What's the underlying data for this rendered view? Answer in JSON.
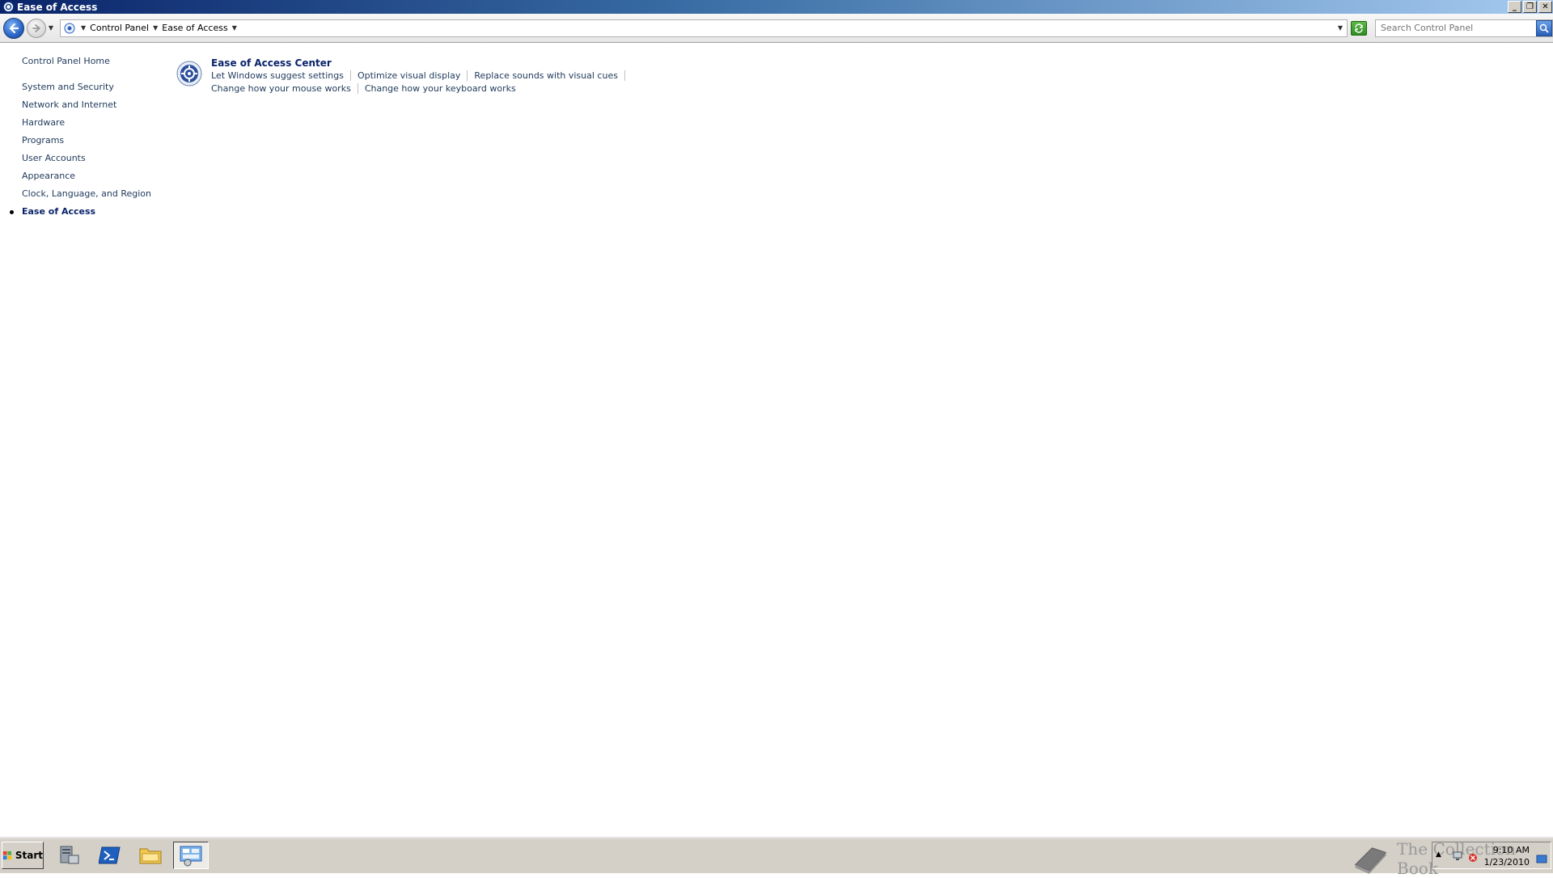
{
  "window": {
    "title": "Ease of Access"
  },
  "navbar": {
    "breadcrumbs": [
      "Control Panel",
      "Ease of Access"
    ],
    "search": {
      "placeholder": "Search Control Panel",
      "value": ""
    }
  },
  "leftnav": {
    "home": "Control Panel Home",
    "items": [
      "System and Security",
      "Network and Internet",
      "Hardware",
      "Programs",
      "User Accounts",
      "Appearance",
      "Clock, Language, and Region",
      "Ease of Access"
    ]
  },
  "content": {
    "task_title": "Ease of Access Center",
    "links_row1": [
      "Let Windows suggest settings",
      "Optimize visual display",
      "Replace sounds with visual cues"
    ],
    "links_row2": [
      "Change how your mouse works",
      "Change how your keyboard works"
    ]
  },
  "taskbar": {
    "start_label": "Start",
    "watermark": "The Collection Book",
    "clock_time": "9:10 AM",
    "clock_date": "1/23/2010"
  },
  "colors": {
    "link": "#1e395b",
    "title_bar_start": "#0a246a",
    "title_bar_end": "#a6caf0",
    "taskbar": "#d4d0c8"
  }
}
